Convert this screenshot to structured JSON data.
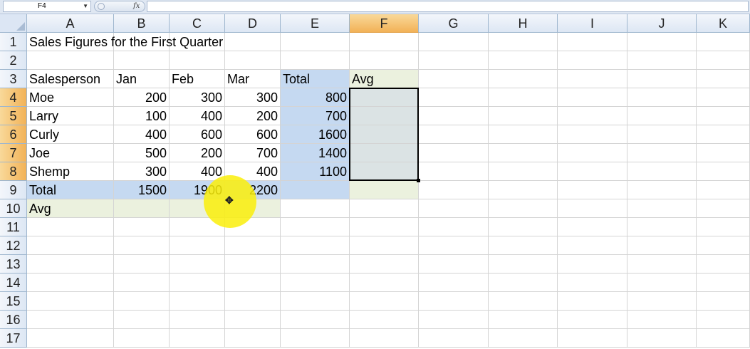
{
  "formula_bar": {
    "name_box": "F4",
    "fx_label": "fx",
    "formula": ""
  },
  "columns": [
    "A",
    "B",
    "C",
    "D",
    "E",
    "F",
    "G",
    "H",
    "I",
    "J",
    "K"
  ],
  "selected_column": "F",
  "rows": [
    "1",
    "2",
    "3",
    "4",
    "5",
    "6",
    "7",
    "8",
    "9",
    "10",
    "11",
    "12",
    "13",
    "14",
    "15",
    "16",
    "17"
  ],
  "selected_rows": [
    "4",
    "5",
    "6",
    "7",
    "8"
  ],
  "sheet": {
    "title": "Sales Figures for the First Quarter",
    "headers": {
      "a": "Salesperson",
      "b": "Jan",
      "c": "Feb",
      "d": "Mar",
      "e": "Total",
      "f": "Avg"
    },
    "data": [
      {
        "name": "Moe",
        "jan": "200",
        "feb": "300",
        "mar": "300",
        "total": "800"
      },
      {
        "name": "Larry",
        "jan": "100",
        "feb": "400",
        "mar": "200",
        "total": "700"
      },
      {
        "name": "Curly",
        "jan": "400",
        "feb": "600",
        "mar": "600",
        "total": "1600"
      },
      {
        "name": "Joe",
        "jan": "500",
        "feb": "200",
        "mar": "700",
        "total": "1400"
      },
      {
        "name": "Shemp",
        "jan": "300",
        "feb": "400",
        "mar": "400",
        "total": "1100"
      }
    ],
    "total_row": {
      "label": "Total",
      "jan": "1500",
      "feb": "1900",
      "mar": "2200"
    },
    "avg_row": {
      "label": "Avg"
    }
  },
  "colors": {
    "selection_header": "#f2b257",
    "total_fill": "#c5d9f1",
    "avg_fill": "#ebf1de",
    "cursor_highlight": "#faee0a"
  },
  "cursor_icon": "move-crosshair"
}
